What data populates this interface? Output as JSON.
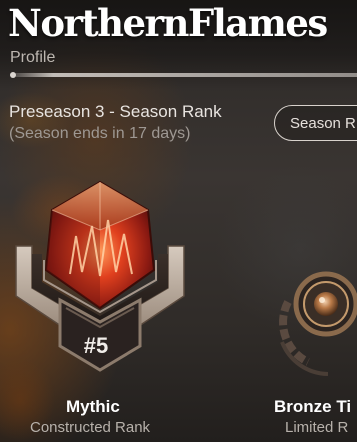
{
  "header": {
    "logo_text": "NorthernFlames",
    "breadcrumb": "Profile"
  },
  "season": {
    "title": "Preseason 3 - Season Rank",
    "subtitle": "(Season ends in 17 days)",
    "button_label": "Season R"
  },
  "ranks": [
    {
      "tier": "Mythic",
      "format": "Constructed Rank",
      "position": "#5",
      "gem_color": "#c8321e",
      "frame_color": "#b8a89a",
      "emblem_icon": "mythic-rank-emblem-icon"
    },
    {
      "tier": "Bronze Ti",
      "format": "Limited R",
      "frame_color": "#7a5a3a",
      "emblem_icon": "bronze-rank-emblem-icon"
    }
  ],
  "colors": {
    "title_text": "#ffffff",
    "muted_text": "#9e9893",
    "accent_fire": "#c8321e"
  }
}
